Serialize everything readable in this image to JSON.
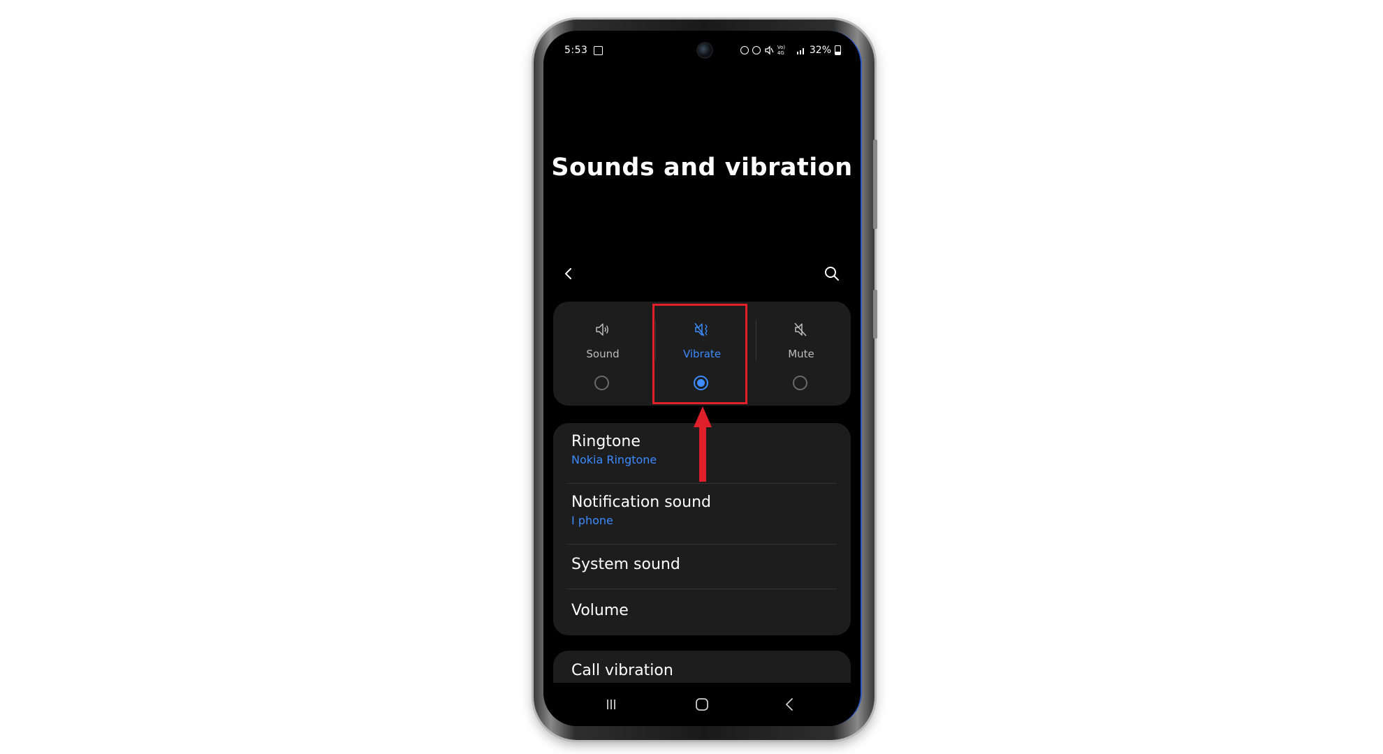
{
  "status_bar": {
    "time": "5:53",
    "signal_text": "Vo) 4G",
    "battery": "32%"
  },
  "page": {
    "title": "Sounds and vibration"
  },
  "toolbar": {
    "back_icon": "chevron-left-icon",
    "search_icon": "search-icon"
  },
  "sound_mode": {
    "options": [
      {
        "label": "Sound",
        "icon": "speaker-icon",
        "selected": false
      },
      {
        "label": "Vibrate",
        "icon": "vibrate-icon",
        "selected": true
      },
      {
        "label": "Mute",
        "icon": "mute-icon",
        "selected": false
      }
    ],
    "accent_color": "#3d8bff",
    "highlight_color": "#e0202a"
  },
  "settings": {
    "ringtone": {
      "title": "Ringtone",
      "value": "Nokia Ringtone"
    },
    "notification_sound": {
      "title": "Notification sound",
      "value": "I phone"
    },
    "system_sound": {
      "title": "System sound"
    },
    "volume": {
      "title": "Volume"
    },
    "call_vibration": {
      "title": "Call vibration"
    }
  },
  "nav_bar": {
    "recents_icon": "recents-icon",
    "home_icon": "home-icon",
    "back_icon": "back-icon"
  }
}
